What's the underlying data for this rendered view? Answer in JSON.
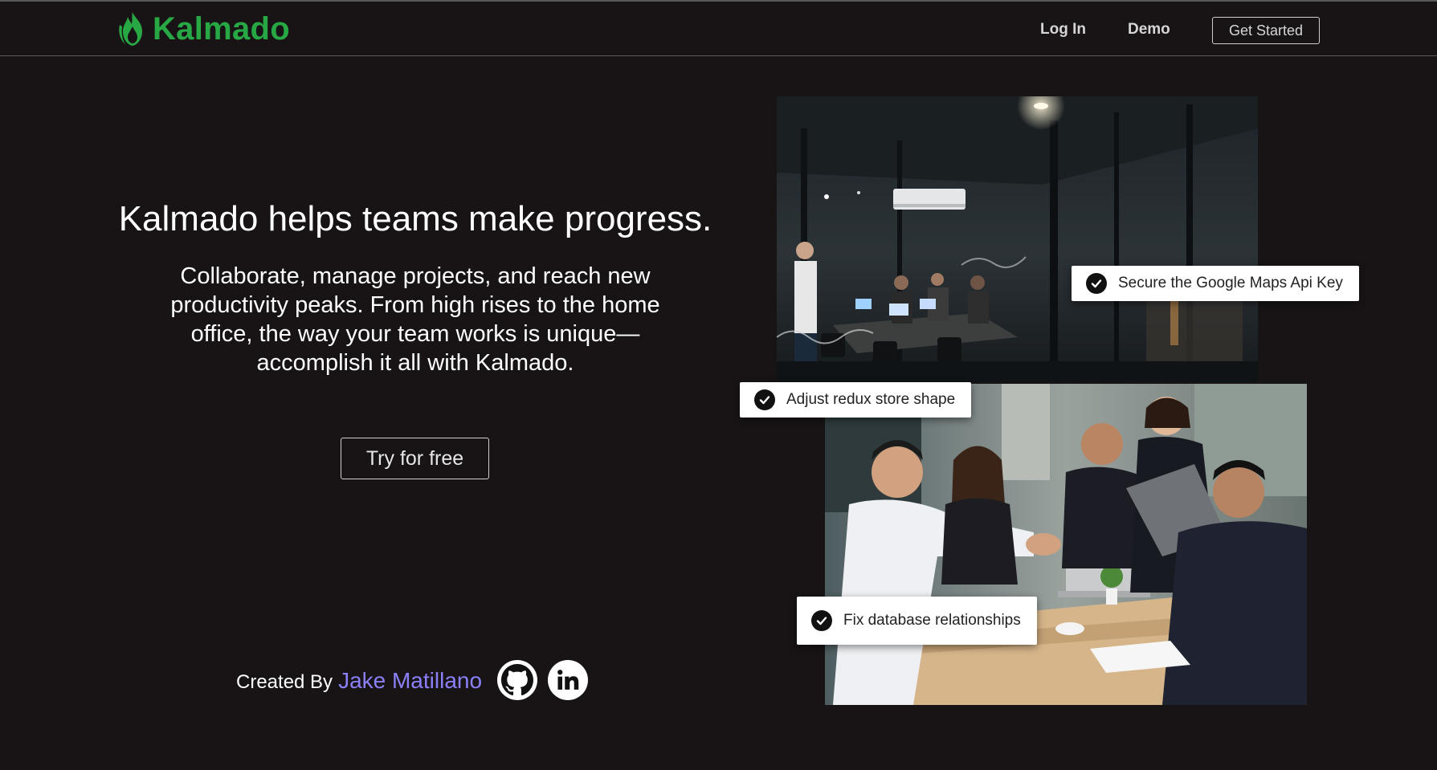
{
  "header": {
    "brand": "Kalmado",
    "nav": {
      "login": "Log In",
      "demo": "Demo",
      "get_started": "Get Started"
    }
  },
  "hero": {
    "headline": "Kalmado helps teams make progress.",
    "subhead": "Collaborate, manage projects, and reach new productivity peaks. From high rises to the home office, the way your team works is unique—accomplish it all with Kalmado.",
    "cta": "Try for free"
  },
  "tasks": [
    {
      "label": "Secure the Google Maps Api Key"
    },
    {
      "label": "Adjust redux store shape"
    },
    {
      "label": "Fix database relationships"
    }
  ],
  "footer": {
    "created_by": "Created By",
    "author": "Jake Matillano",
    "social": [
      "github-icon",
      "linkedin-icon"
    ]
  },
  "colors": {
    "background": "#181415",
    "brand": "#27a844",
    "author_link": "#8b80f9"
  }
}
